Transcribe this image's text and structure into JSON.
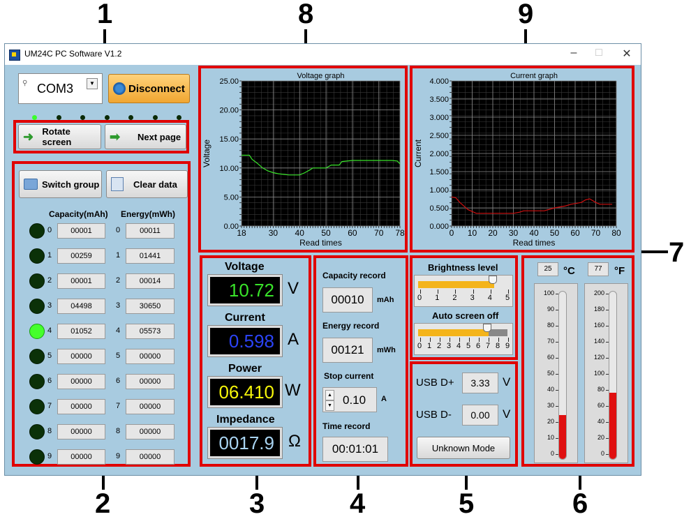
{
  "window": {
    "title": "UM24C PC Software V1.2"
  },
  "markers": [
    "1",
    "2",
    "3",
    "4",
    "5",
    "6",
    "7",
    "8",
    "9"
  ],
  "connection": {
    "port": "COM3",
    "disconnect_label": "Disconnect"
  },
  "nav": {
    "rotate_label": "Rotate screen",
    "next_label": "Next page"
  },
  "group": {
    "switch_label": "Switch group",
    "clear_label": "Clear data",
    "capacity_header": "Capacity(mAh)",
    "energy_header": "Energy(mWh)",
    "active_index": 4,
    "rows": [
      {
        "idx": "0",
        "cap": "00001",
        "en": "00011"
      },
      {
        "idx": "1",
        "cap": "00259",
        "en": "01441"
      },
      {
        "idx": "2",
        "cap": "00001",
        "en": "00014"
      },
      {
        "idx": "3",
        "cap": "04498",
        "en": "30650"
      },
      {
        "idx": "4",
        "cap": "01052",
        "en": "05573"
      },
      {
        "idx": "5",
        "cap": "00000",
        "en": "00000"
      },
      {
        "idx": "6",
        "cap": "00000",
        "en": "00000"
      },
      {
        "idx": "7",
        "cap": "00000",
        "en": "00000"
      },
      {
        "idx": "8",
        "cap": "00000",
        "en": "00000"
      },
      {
        "idx": "9",
        "cap": "00000",
        "en": "00000"
      }
    ]
  },
  "readings": {
    "voltage_label": "Voltage",
    "voltage": "10.72",
    "voltage_unit": "V",
    "voltage_color": "#39e32a",
    "current_label": "Current",
    "current": "0.598",
    "current_unit": "A",
    "current_color": "#2b43f5",
    "power_label": "Power",
    "power": "06.410",
    "power_unit": "W",
    "power_color": "#f5f50a",
    "impedance_label": "Impedance",
    "impedance": "0017.9",
    "impedance_unit": "Ω",
    "impedance_color": "#a9d4f2"
  },
  "records": {
    "capacity_label": "Capacity record",
    "capacity": "00010",
    "capacity_unit": "mAh",
    "energy_label": "Energy record",
    "energy": "00121",
    "energy_unit": "mWh",
    "stop_label": "Stop current",
    "stop": "0.10",
    "stop_unit": "A",
    "time_label": "Time record",
    "time": "00:01:01"
  },
  "display": {
    "brightness_label": "Brightness level",
    "brightness_ticks": [
      "0",
      "1",
      "2",
      "3",
      "4",
      "5"
    ],
    "brightness_value": 4.2,
    "screenoff_label": "Auto screen off",
    "screenoff_ticks": [
      "0",
      "1",
      "2",
      "3",
      "4",
      "5",
      "6",
      "7",
      "8",
      "9"
    ],
    "screenoff_value": 7
  },
  "usb": {
    "dplus_label": "USB D+",
    "dplus": "3.33",
    "dminus_label": "USB D-",
    "dminus": "0.00",
    "unit": "V",
    "mode_label": "Unknown Mode"
  },
  "temperature": {
    "c_value": "25",
    "c_unit": "°C",
    "f_value": "77",
    "f_unit": "°F",
    "c_ticks": [
      "100",
      "90",
      "80",
      "70",
      "60",
      "50",
      "40",
      "30",
      "20",
      "10",
      "0"
    ],
    "f_ticks": [
      "200",
      "180",
      "160",
      "140",
      "120",
      "100",
      "80",
      "60",
      "40",
      "20",
      "0"
    ],
    "c_level": 25,
    "c_max": 100,
    "f_level": 77,
    "f_max": 200
  },
  "chart_data": [
    {
      "type": "line",
      "title": "Voltage graph",
      "xlabel": "Read times",
      "ylabel": "Voltage",
      "xlim": [
        18,
        78
      ],
      "ylim": [
        0,
        25
      ],
      "xticks": [
        "18",
        "30",
        "40",
        "50",
        "60",
        "70",
        "78"
      ],
      "yticks": [
        "0.00",
        "5.00",
        "10.00",
        "15.00",
        "20.00",
        "25.00"
      ],
      "series": [
        {
          "color": "#39e32a",
          "x": [
            18,
            21,
            22,
            24,
            26,
            28,
            30,
            32,
            34,
            36,
            38,
            40,
            42,
            44,
            45,
            50,
            52,
            55,
            56,
            60,
            65,
            70,
            75,
            77,
            78
          ],
          "y": [
            12.2,
            12.2,
            11.5,
            10.8,
            10.0,
            9.5,
            9.2,
            9.0,
            8.9,
            8.8,
            8.8,
            8.8,
            9.2,
            9.7,
            10.0,
            10.0,
            10.5,
            10.5,
            11.1,
            11.3,
            11.3,
            11.3,
            11.3,
            11.2,
            10.7
          ]
        }
      ]
    },
    {
      "type": "line",
      "title": "Current graph",
      "xlabel": "Read times",
      "ylabel": "Current",
      "xlim": [
        0,
        80
      ],
      "ylim": [
        0,
        4
      ],
      "xticks": [
        "0",
        "10",
        "20",
        "30",
        "40",
        "50",
        "60",
        "70",
        "80"
      ],
      "yticks": [
        "0.000",
        "0.500",
        "1.000",
        "1.500",
        "2.000",
        "2.500",
        "3.000",
        "3.500",
        "4.000"
      ],
      "series": [
        {
          "color": "#d01010",
          "x": [
            0,
            2,
            4,
            6,
            8,
            10,
            12,
            15,
            20,
            25,
            30,
            33,
            35,
            38,
            40,
            45,
            50,
            55,
            58,
            60,
            63,
            65,
            67,
            70,
            72,
            75,
            78
          ],
          "y": [
            0.8,
            0.78,
            0.65,
            0.55,
            0.45,
            0.4,
            0.35,
            0.35,
            0.35,
            0.35,
            0.35,
            0.38,
            0.42,
            0.42,
            0.42,
            0.42,
            0.5,
            0.55,
            0.6,
            0.62,
            0.65,
            0.72,
            0.75,
            0.65,
            0.6,
            0.6,
            0.6
          ]
        }
      ]
    }
  ]
}
